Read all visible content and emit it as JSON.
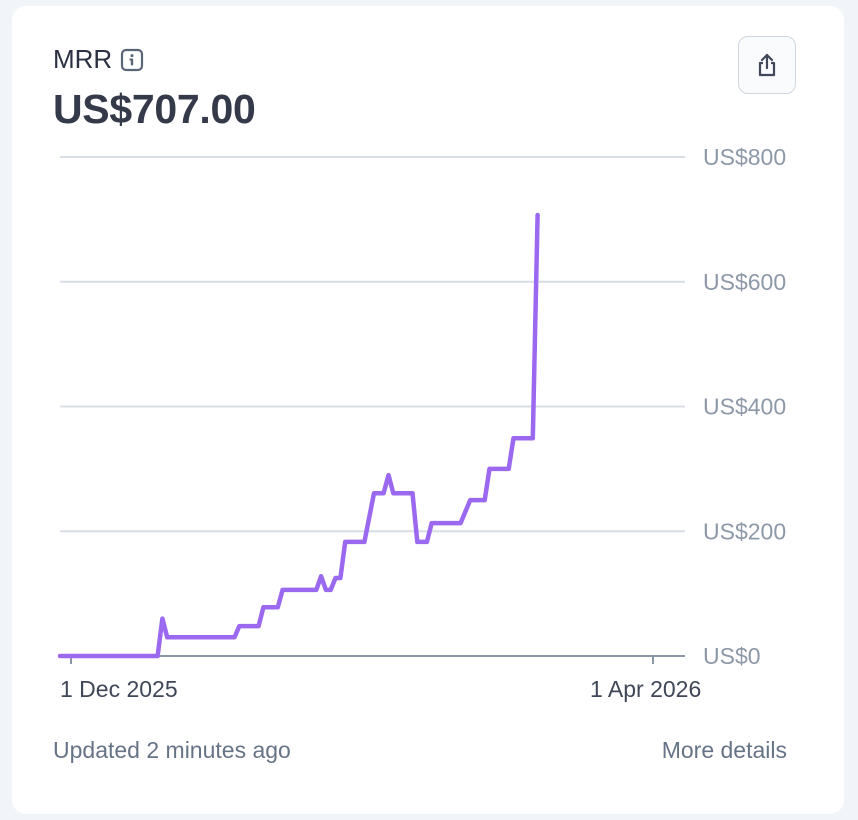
{
  "card": {
    "title": "MRR",
    "value": "US$707.00",
    "footer_updated": "Updated 2 minutes ago",
    "footer_link": "More details"
  },
  "colors": {
    "line": "#9b68f0",
    "grid": "#d8dee6",
    "axis_text": "#8d98a8"
  },
  "chart_data": {
    "type": "line",
    "title": "",
    "xlabel": "",
    "ylabel": "",
    "ylim": [
      0,
      800
    ],
    "y_ticks": [
      0,
      200,
      400,
      600,
      800
    ],
    "y_tick_labels": [
      "US$0",
      "US$200",
      "US$400",
      "US$600",
      "US$800"
    ],
    "x_tick_labels": [
      {
        "date": "2025-12-01",
        "label": "1 Dec 2025"
      },
      {
        "date": "2026-04-01",
        "label": "1 Apr 2026"
      }
    ],
    "grid": true,
    "series": [
      {
        "name": "",
        "points": [
          [
            "2025-11-28",
            0
          ],
          [
            "2025-12-19",
            0
          ],
          [
            "2025-12-20",
            60
          ],
          [
            "2025-12-21",
            30
          ],
          [
            "2026-01-04",
            30
          ],
          [
            "2026-01-05",
            48
          ],
          [
            "2026-01-09",
            48
          ],
          [
            "2026-01-10",
            78
          ],
          [
            "2026-01-13",
            78
          ],
          [
            "2026-01-14",
            106
          ],
          [
            "2026-01-21",
            106
          ],
          [
            "2026-01-22",
            128
          ],
          [
            "2026-01-23",
            106
          ],
          [
            "2026-01-24",
            106
          ],
          [
            "2026-01-25",
            125
          ],
          [
            "2026-01-26",
            125
          ],
          [
            "2026-01-27",
            183
          ],
          [
            "2026-01-31",
            183
          ],
          [
            "2026-02-02",
            261
          ],
          [
            "2026-02-04",
            261
          ],
          [
            "2026-02-05",
            290
          ],
          [
            "2026-02-06",
            261
          ],
          [
            "2026-02-10",
            261
          ],
          [
            "2026-02-11",
            183
          ],
          [
            "2026-02-13",
            183
          ],
          [
            "2026-02-14",
            213
          ],
          [
            "2026-02-20",
            213
          ],
          [
            "2026-02-22",
            250
          ],
          [
            "2026-02-25",
            250
          ],
          [
            "2026-02-26",
            300
          ],
          [
            "2026-03-02",
            300
          ],
          [
            "2026-03-03",
            349
          ],
          [
            "2026-03-07",
            349
          ],
          [
            "2026-03-08",
            707
          ]
        ]
      }
    ]
  }
}
